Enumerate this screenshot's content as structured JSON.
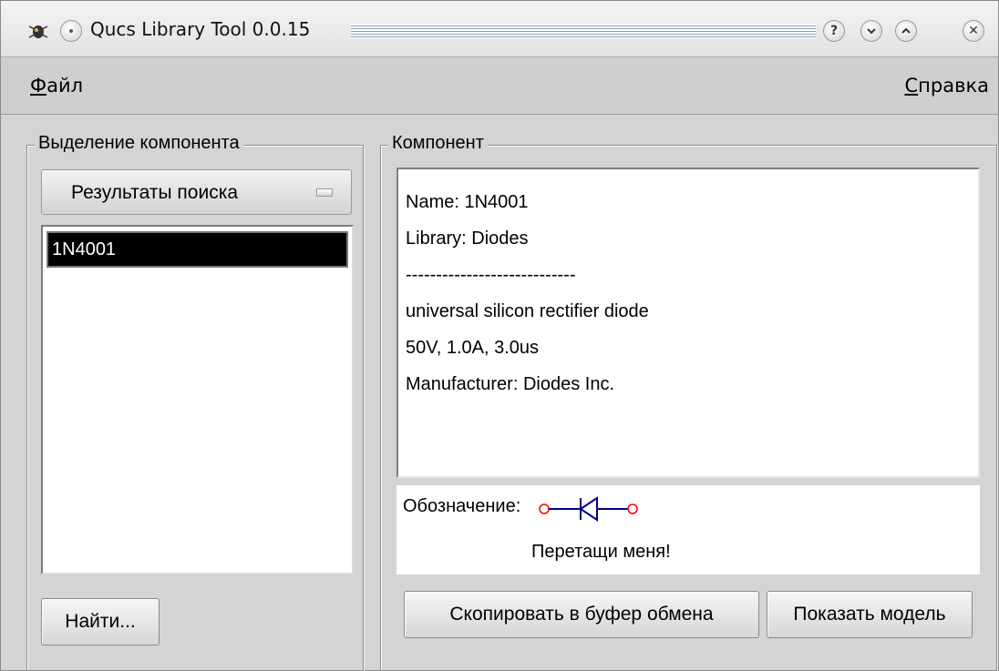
{
  "window": {
    "title": "Qucs Library Tool 0.0.15",
    "buttons": {
      "help": "?",
      "minimize": "⌄",
      "maximize": "⌃"
    }
  },
  "menu": {
    "file": {
      "mnemonic": "Ф",
      "rest": "айл"
    },
    "help": {
      "mnemonic": "С",
      "rest": "правка"
    }
  },
  "left_panel": {
    "title": "Выделение компонента",
    "combo_value": "Результаты поиска",
    "list_items": [
      "1N4001"
    ],
    "search_button": "Найти..."
  },
  "right_panel": {
    "title": "Компонент",
    "details": [
      "Name: 1N4001",
      "Library: Diodes",
      "----------------------------",
      "universal silicon rectifier diode",
      "50V, 1.0A, 3.0us",
      "Manufacturer: Diodes Inc."
    ],
    "symbol_label": "Обозначение:",
    "drag_hint": "Перетащи меня!",
    "copy_button": "Скопировать в буфер обмена",
    "model_button": "Показать модель"
  },
  "colors": {
    "symbol_line": "#00008b",
    "symbol_port": "#ff0000"
  }
}
